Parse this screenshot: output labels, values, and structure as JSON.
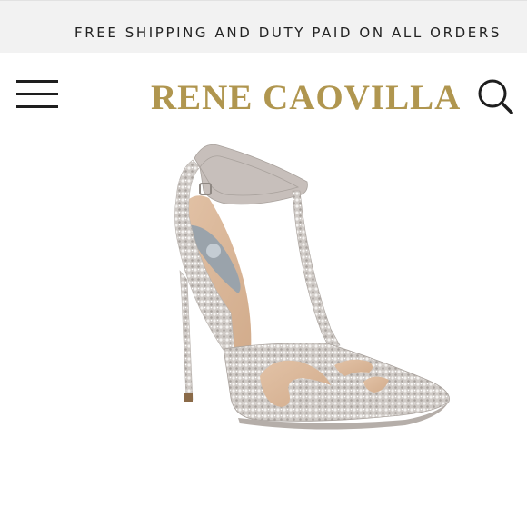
{
  "promo": {
    "text": "FREE SHIPPING AND DUTY PAID ON ALL ORDERS"
  },
  "header": {
    "brand": "RENE CAOVILLA",
    "menu_icon": "hamburger-menu-icon",
    "search_icon": "search-icon"
  },
  "colors": {
    "brand_gold": "#b0964f",
    "promo_bg": "#f2f2f2",
    "icon_dark": "#1e1e1e"
  },
  "product": {
    "image": "crystal-embellished-t-bar-stiletto-pump"
  }
}
